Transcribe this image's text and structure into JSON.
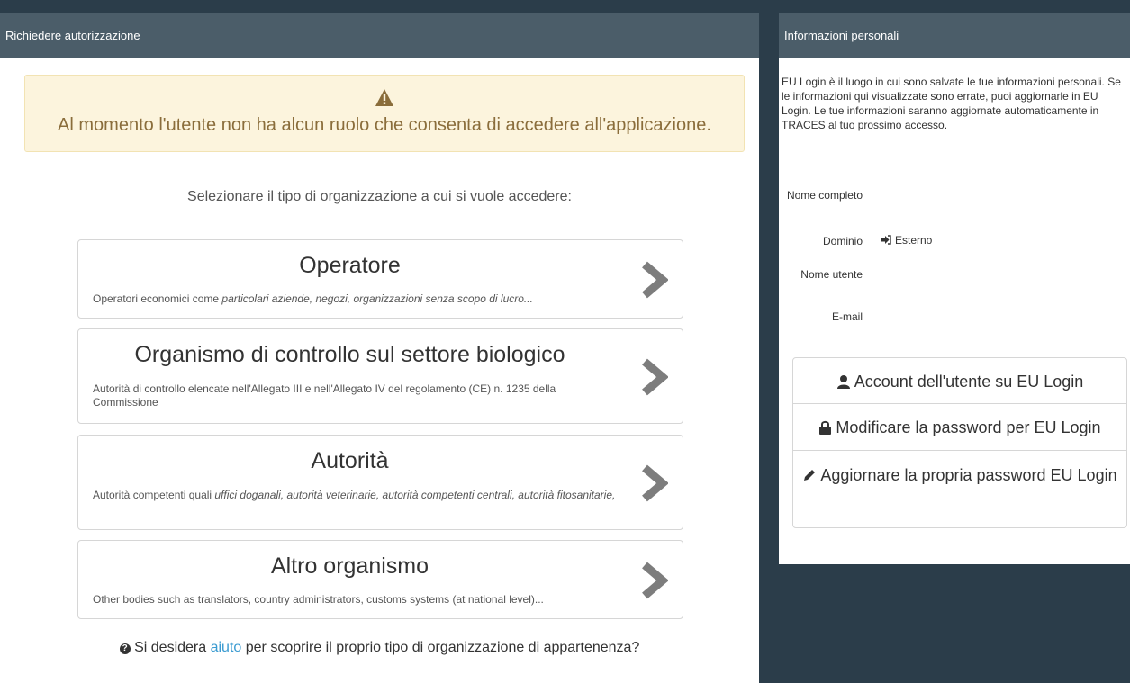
{
  "left_panel": {
    "title": "Richiedere autorizzazione",
    "alert_message": "Al momento l'utente non ha alcun ruolo che consenta di accedere all'applicazione.",
    "prompt": "Selezionare il tipo di organizzazione a cui si vuole accedere:",
    "organizations": [
      {
        "title": "Operatore",
        "desc_plain": "Operatori economici come ",
        "desc_em": "particolari aziende, negozi, organizzazioni senza scopo di lucro..."
      },
      {
        "title": "Organismo di controllo sul settore biologico",
        "desc_plain": "Autorità di controllo elencate nell'Allegato III e nell'Allegato IV del regolamento (CE) n. 1235 della Commissione",
        "desc_em": ""
      },
      {
        "title": "Autorità",
        "desc_plain": "Autorità competenti quali ",
        "desc_em": "uffici doganali, autorità veterinarie, autorità competenti centrali, autorità fitosanitarie,"
      },
      {
        "title": "Altro organismo",
        "desc_plain": "Other bodies such as translators, country administrators, customs systems (at national level)...",
        "desc_em": ""
      }
    ],
    "help": {
      "before": "Si desidera ",
      "link": "aiuto",
      "after": " per scoprire il proprio tipo di organizzazione di appartenenza?"
    }
  },
  "right_panel": {
    "title": "Informazioni personali",
    "intro": "EU Login è il luogo in cui sono salvate le tue informazioni personali. Se le informazioni qui visualizzate sono errate, puoi aggiornarle in EU Login. Le tue informazioni saranno aggiornate automaticamente in TRACES al tuo prossimo accesso.",
    "fields": {
      "full_name_label": "Nome completo",
      "domain_label": "Dominio",
      "domain_value": "Esterno",
      "username_label": "Nome utente",
      "email_label": "E-mail"
    },
    "buttons": {
      "account": "Account dell'utente su EU Login",
      "change_password": "Modificare la password per EU Login",
      "update_password": "Aggiornare la propria password EU Login"
    }
  },
  "colors": {
    "page_bg": "#2b3d4a",
    "panel_header": "#4b5d69",
    "alert_bg": "#fcf4dd",
    "alert_text": "#8a6d3b",
    "link": "#3a9bd1",
    "chevron": "#7d7d7d"
  },
  "icons": {
    "alert": "warning-icon",
    "chevron": "chevron-right-icon",
    "help": "question-circle-icon",
    "domain": "sign-in-icon",
    "account": "user-icon",
    "change_password": "lock-icon",
    "update_password": "pencil-icon"
  }
}
